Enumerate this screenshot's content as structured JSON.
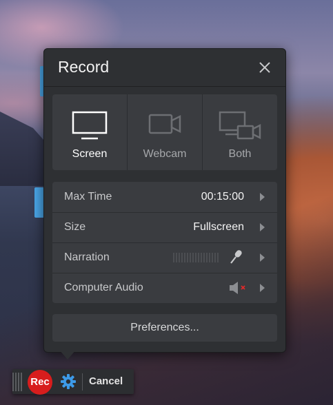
{
  "dialog": {
    "title": "Record"
  },
  "modes": [
    {
      "label": "Screen",
      "icon": "monitor-icon",
      "active": true
    },
    {
      "label": "Webcam",
      "icon": "camera-icon",
      "active": false
    },
    {
      "label": "Both",
      "icon": "screen-and-camera-icon",
      "active": false
    }
  ],
  "options": {
    "max_time": {
      "label": "Max Time",
      "value": "00:15:00"
    },
    "size": {
      "label": "Size",
      "value": "Fullscreen"
    },
    "narration": {
      "label": "Narration",
      "icon": "microphone-icon"
    },
    "computer_audio": {
      "label": "Computer Audio",
      "icon": "speaker-muted-icon"
    }
  },
  "preferences_label": "Preferences...",
  "toolbar": {
    "rec_label": "Rec",
    "cancel_label": "Cancel"
  },
  "colors": {
    "accent_blue": "#3d9be9",
    "rec_red": "#d81d1d",
    "panel_bg": "#2e3033"
  }
}
